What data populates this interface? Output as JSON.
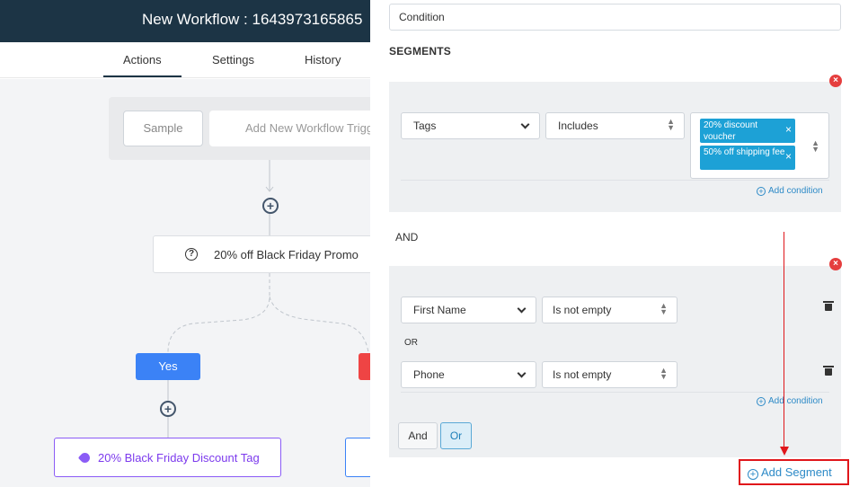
{
  "header": {
    "title": "New Workflow : 1643973165865"
  },
  "tabs": [
    {
      "label": "Actions",
      "active": true
    },
    {
      "label": "Settings",
      "active": false
    },
    {
      "label": "History",
      "active": false
    }
  ],
  "canvas": {
    "sample_label": "Sample",
    "add_trigger_label": "Add New Workflow Trigger",
    "condition_node_label": "20% off Black Friday Promo",
    "condition_icon": "question-circle-icon",
    "yes_label": "Yes",
    "tag_node_label": "20% Black Friday Discount Tag",
    "tag_icon": "tag-icon"
  },
  "panel": {
    "condition_name_value": "Condition",
    "segments_heading": "SEGMENTS",
    "segment1": {
      "field": "Tags",
      "operator": "Includes",
      "chips": [
        "20% discount voucher",
        "50% off shipping fee"
      ],
      "add_condition": "Add condition"
    },
    "and_separator": "AND",
    "segment2": {
      "row1": {
        "field": "First Name",
        "operator": "Is not empty"
      },
      "or_separator": "OR",
      "row2": {
        "field": "Phone",
        "operator": "Is not empty"
      },
      "add_condition": "Add condition",
      "and_button": "And",
      "or_button": "Or"
    },
    "add_segment_label": "Add Segment"
  },
  "colors": {
    "header_bg": "#1c3445",
    "accent_blue": "#2d8ac7",
    "chip_bg": "#1da1d6",
    "yes_bg": "#3b82f6",
    "delete_red": "#e53e3e",
    "annotation_red": "#e0161b",
    "tag_purple": "#8b5cf6"
  }
}
